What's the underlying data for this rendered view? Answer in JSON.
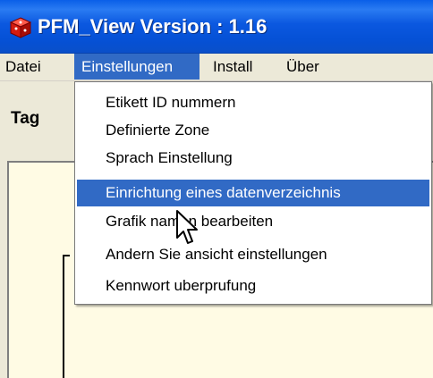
{
  "window": {
    "title": "PFM_View Version :  1.16",
    "icon": "app-cube-icon",
    "titlebar_color": "#0a5fe8"
  },
  "menubar": {
    "items": [
      {
        "label": "Datei"
      },
      {
        "label": "Einstellungen",
        "active": true
      },
      {
        "label": "Install"
      },
      {
        "label": "Über"
      }
    ],
    "highlight_color": "#316ac5"
  },
  "tab": {
    "label": "Tag"
  },
  "dropdown": {
    "items": [
      {
        "label": "Etikett ID nummern"
      },
      {
        "label": "Definierte Zone"
      },
      {
        "label": "Sprach Einstellung"
      },
      {
        "label": "Einrichtung eines datenverzeichnis",
        "highlighted": true
      },
      {
        "label": "Grafik namen bearbeiten"
      },
      {
        "label": "Andern Sie ansicht einstellungen"
      },
      {
        "label": "Kennwort uberprufung"
      }
    ]
  },
  "content": {
    "background": "#fffbe4"
  }
}
